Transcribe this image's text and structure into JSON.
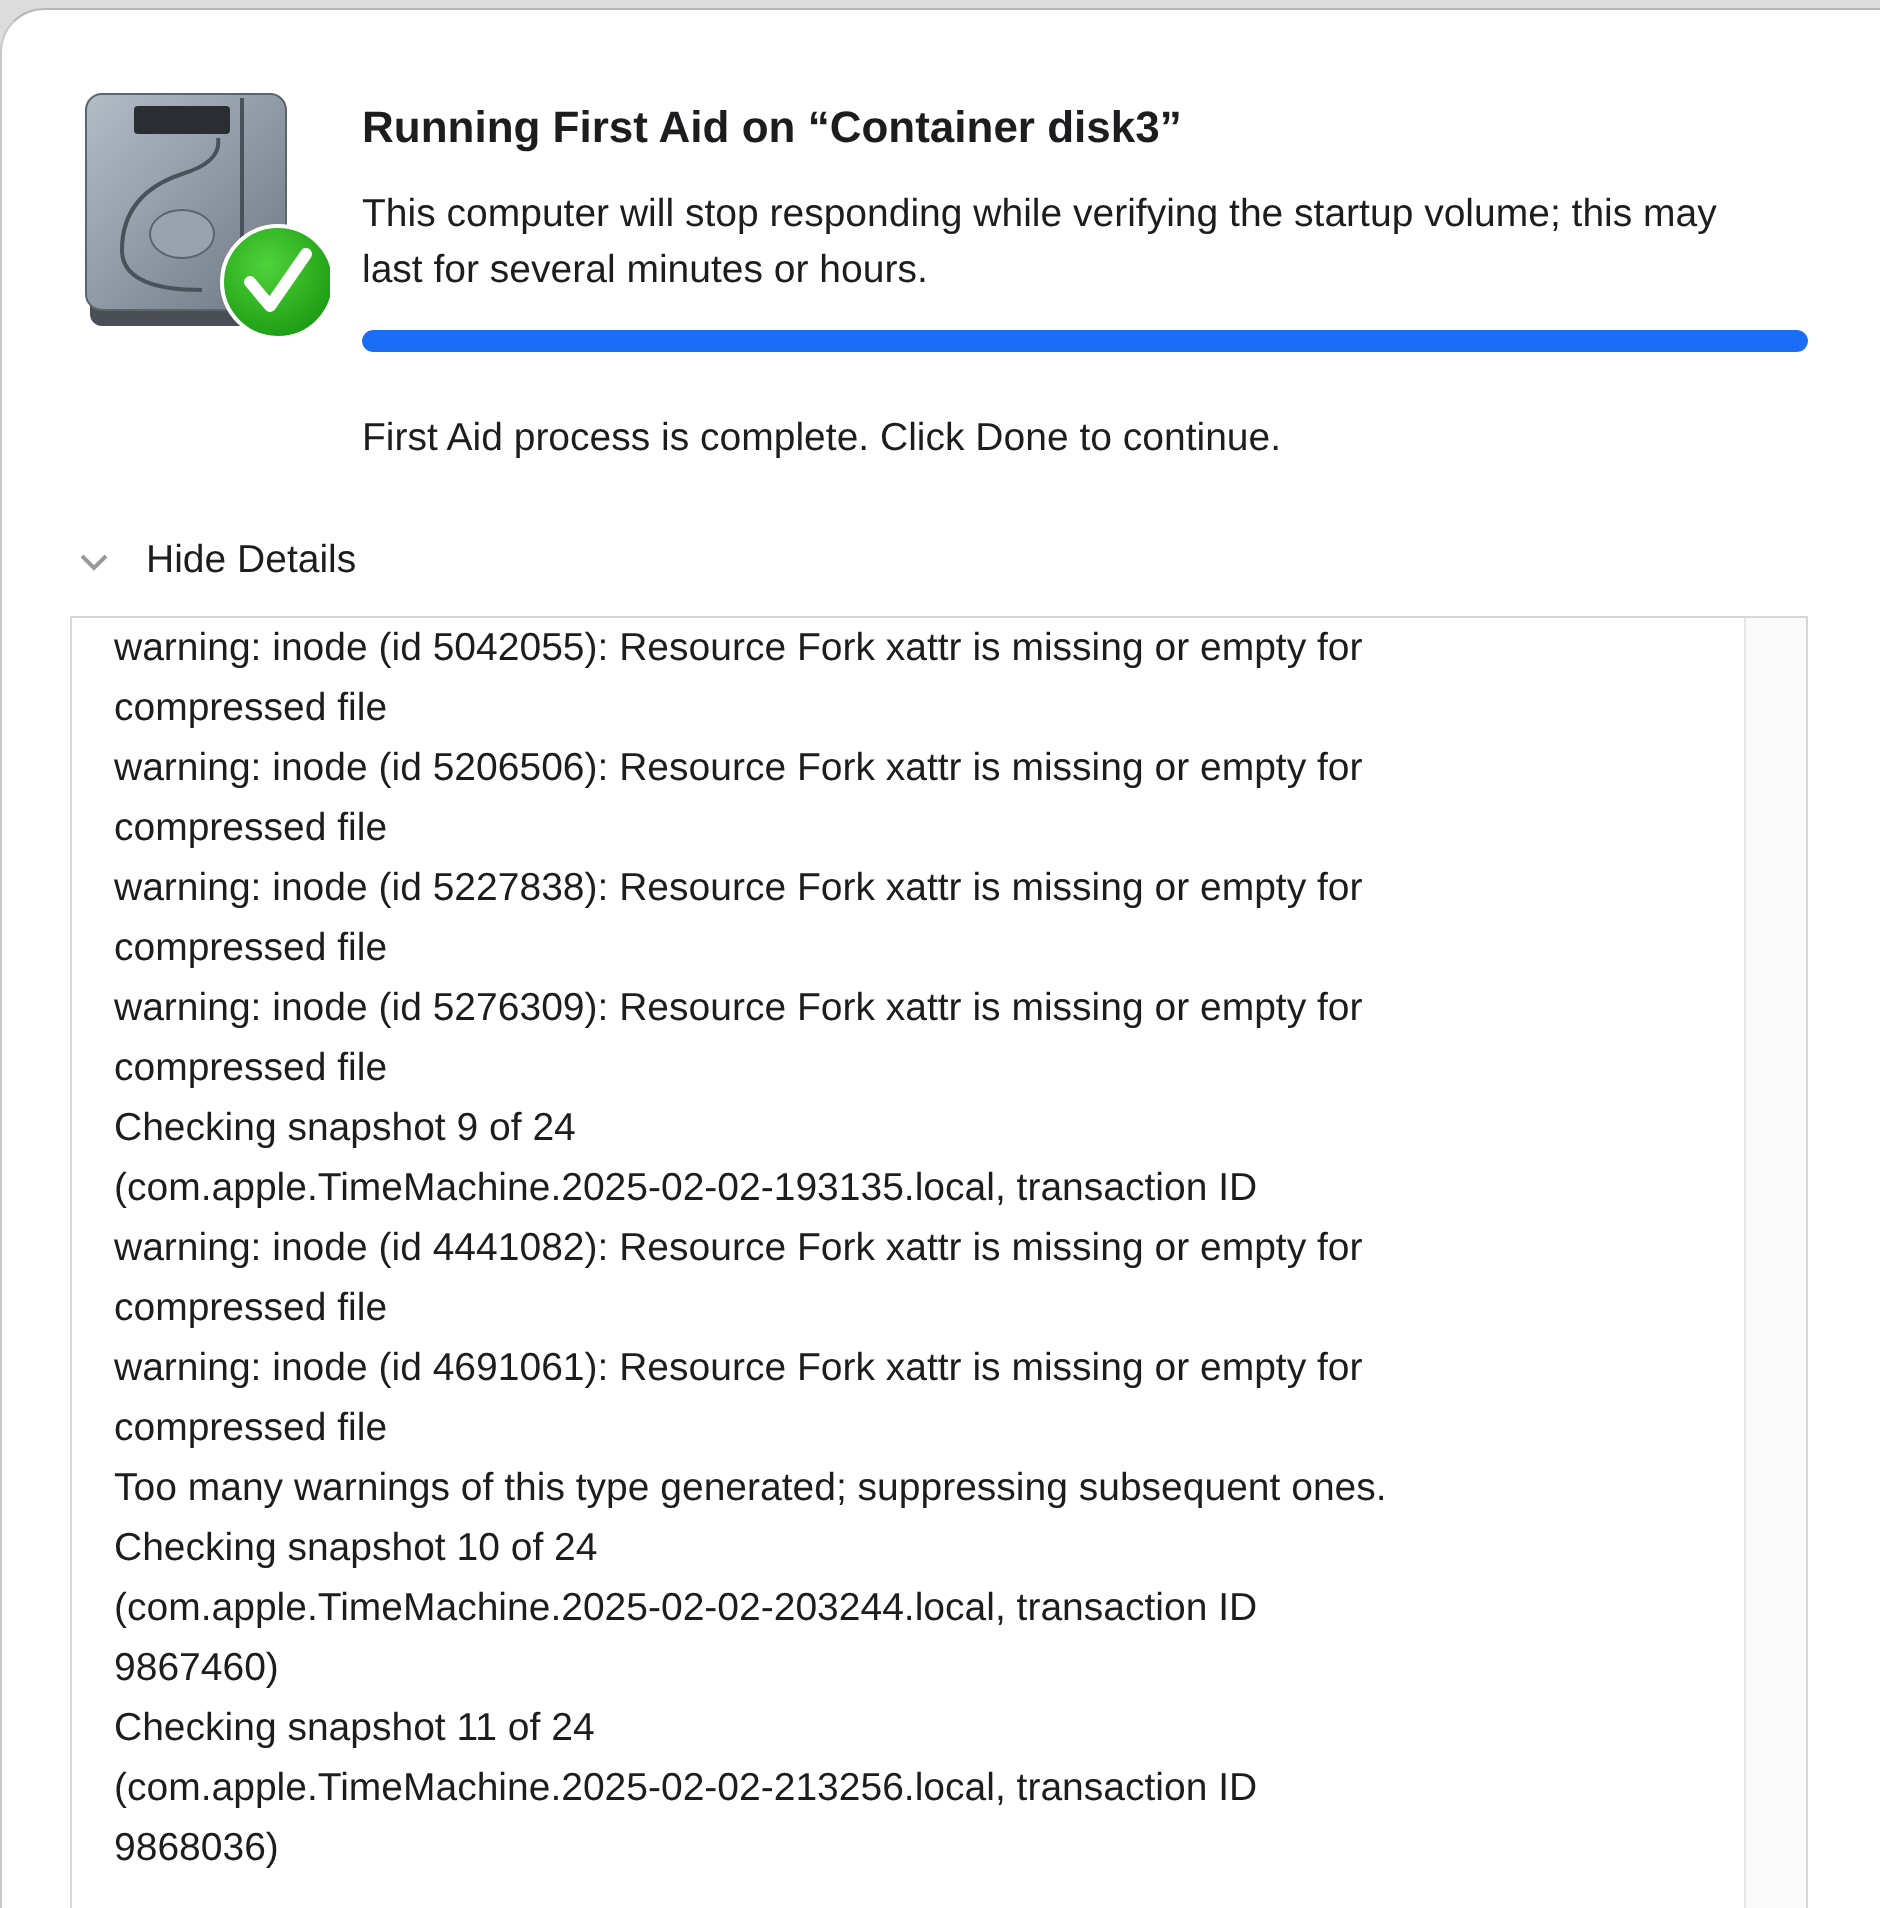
{
  "dialog": {
    "title": "Running First Aid on “Container disk3”",
    "message": "This computer will stop responding while verifying the startup volume; this may last for several minutes or hours.",
    "progress": {
      "level": 1
    },
    "status": "First Aid process is complete. Click Done to continue.",
    "details_toggle": {
      "label": "Hide Details",
      "expanded": true
    },
    "log": [
      {
        "lines": [
          "warning: inode (id 5042055): Resource Fork xattr is missing or empty for",
          "compressed file"
        ]
      },
      {
        "lines": [
          "warning: inode (id 5206506): Resource Fork xattr is missing or empty for",
          "compressed file"
        ]
      },
      {
        "lines": [
          "warning: inode (id 5227838): Resource Fork xattr is missing or empty for",
          "compressed file"
        ]
      },
      {
        "lines": [
          "warning: inode (id 5276309): Resource Fork xattr is missing or empty for",
          "compressed file"
        ]
      },
      {
        "lines": [
          "Checking snapshot 9 of 24",
          "(com.apple.TimeMachine.2025-02-02-193135.local, transaction ID"
        ]
      },
      {
        "lines": [
          "warning: inode (id 4441082): Resource Fork xattr is missing or empty for",
          "compressed file"
        ]
      },
      {
        "lines": [
          "warning: inode (id 4691061): Resource Fork xattr is missing or empty for",
          "compressed file"
        ]
      },
      {
        "lines": [
          "Too many warnings of this type generated; suppressing subsequent ones."
        ]
      },
      {
        "lines": [
          "Checking snapshot 10 of 24",
          "(com.apple.TimeMachine.2025-02-02-203244.local, transaction ID",
          "9867460)"
        ]
      },
      {
        "lines": [
          "Checking snapshot 11 of 24",
          "(com.apple.TimeMachine.2025-02-02-213256.local, transaction ID",
          "9868036)"
        ]
      }
    ]
  }
}
